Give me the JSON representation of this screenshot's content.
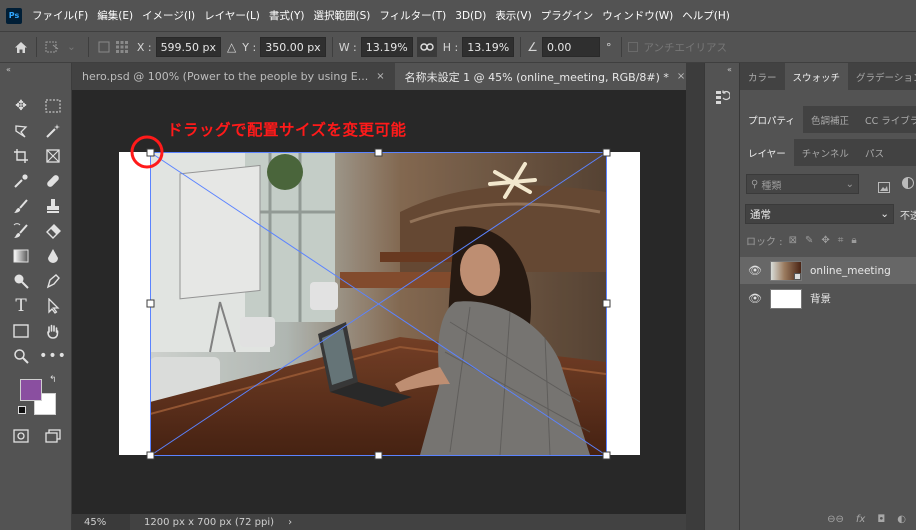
{
  "app": {
    "logo": "Ps",
    "menu": [
      "ファイル(F)",
      "編集(E)",
      "イメージ(I)",
      "レイヤー(L)",
      "書式(Y)",
      "選択範囲(S)",
      "フィルター(T)",
      "3D(D)",
      "表示(V)",
      "プラグイン",
      "ウィンドウ(W)",
      "ヘルプ(H)"
    ]
  },
  "options": {
    "x_label": "X :",
    "x_value": "599.50 px",
    "y_label": "Y :",
    "y_value": "350.00 px",
    "w_label": "W :",
    "w_value": "13.19%",
    "h_label": "H :",
    "h_value": "13.19%",
    "angle_value": "0.00",
    "angle_unit": "°",
    "antialias_label": "アンチエイリアス"
  },
  "document_tabs": [
    {
      "label": "hero.psd @ 100% (Power to the people by using E...",
      "close": "×",
      "active": false
    },
    {
      "label": "名称未設定 1 @ 45% (online_meeting, RGB/8#) *",
      "close": "×",
      "active": true
    }
  ],
  "annotation": "ドラッグで配置サイズを変更可能",
  "status": {
    "zoom": "45%",
    "doc_size": "1200 px x 700 px (72 ppi)",
    "arrow": "›"
  },
  "panels": {
    "top_tabs": [
      "カラー",
      "スウォッチ",
      "グラデーション"
    ],
    "top_active": 1,
    "mid_tabs": [
      "プロパティ",
      "色調補正",
      "CC ライブラリ"
    ],
    "mid_active": 0,
    "layer_tabs": [
      "レイヤー",
      "チャンネル",
      "パス"
    ],
    "layer_active": 0,
    "search_placeholder": "種類",
    "blend_mode": "通常",
    "opacity_label": "不透",
    "lock_label": "ロック :",
    "layers": [
      {
        "name": "online_meeting",
        "selected": true
      },
      {
        "name": "背景",
        "selected": false
      }
    ]
  },
  "colors": {
    "foreground": "#8a4fa0",
    "background": "#ffffff",
    "annotation": "#ff1a1a",
    "transform_line": "#5b83ff"
  }
}
